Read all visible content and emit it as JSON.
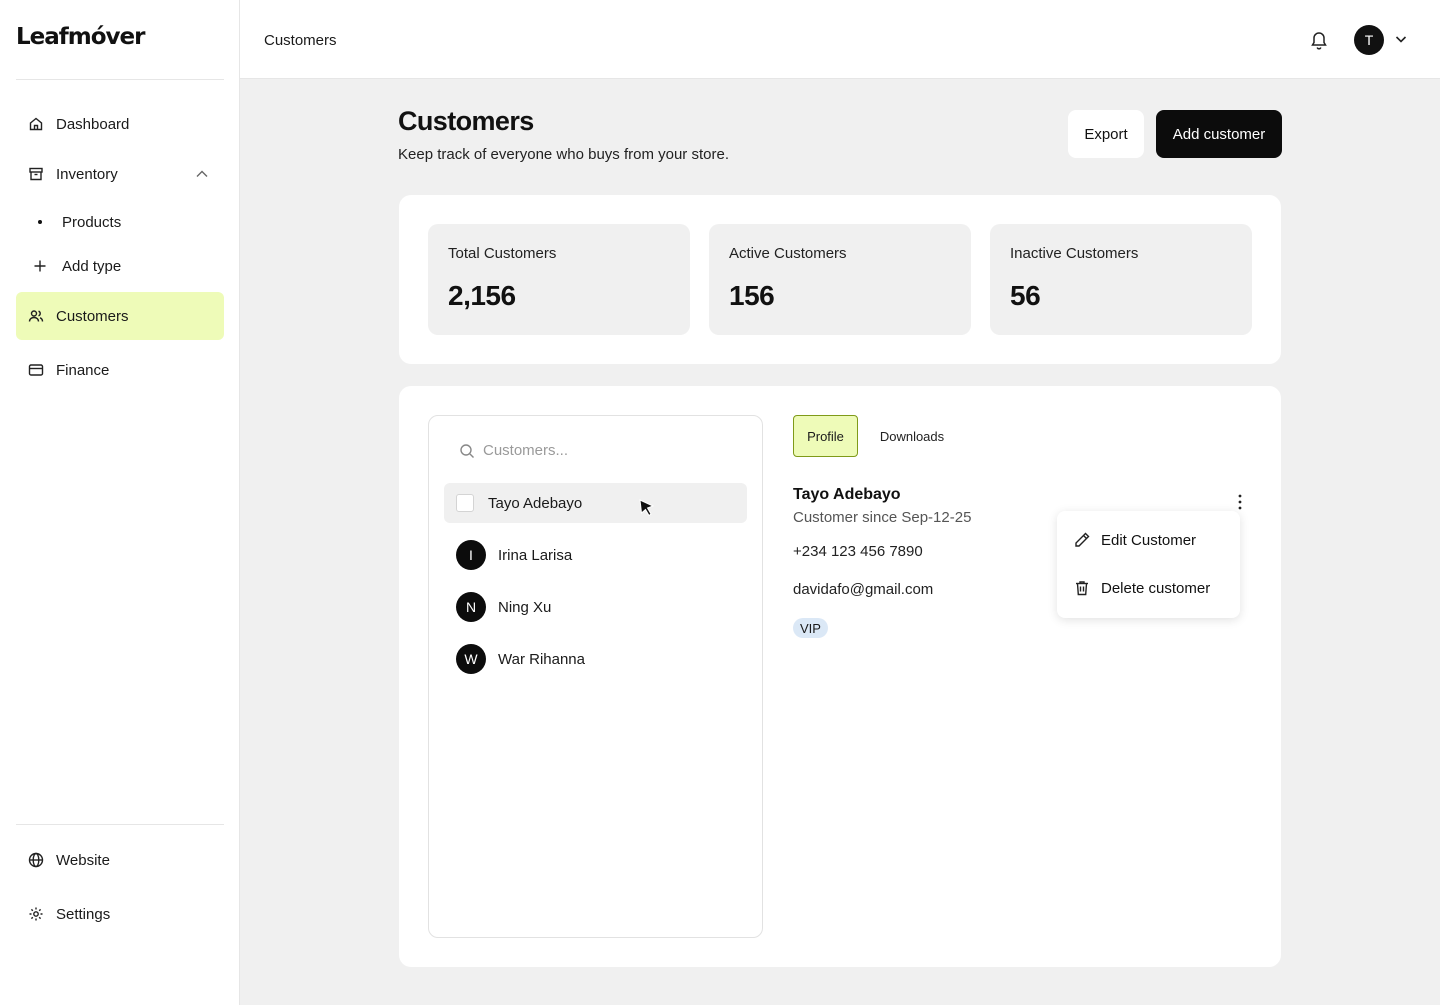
{
  "brand": {
    "name": "Leafmóver"
  },
  "sidebar": {
    "items": [
      {
        "label": "Dashboard",
        "icon": "home-icon"
      },
      {
        "label": "Inventory",
        "icon": "archive-icon"
      },
      {
        "label": "Customers",
        "icon": "users-icon"
      },
      {
        "label": "Finance",
        "icon": "credit-card-icon"
      }
    ],
    "inventory_sub": [
      {
        "label": "Products"
      },
      {
        "label": "Add type"
      }
    ],
    "bottom_items": [
      {
        "label": "Website",
        "icon": "globe-icon"
      },
      {
        "label": "Settings",
        "icon": "gear-icon"
      }
    ]
  },
  "topbar": {
    "breadcrumb": "Customers",
    "avatar_initial": "T"
  },
  "header": {
    "title": "Customers",
    "subtitle": "Keep track of everyone who buys from your store.",
    "export_label": "Export",
    "add_label": "Add customer"
  },
  "stats": [
    {
      "label": "Total Customers",
      "value": "2,156"
    },
    {
      "label": "Active Customers",
      "value": "156"
    },
    {
      "label": "Inactive Customers",
      "value": "56"
    }
  ],
  "customer_list": {
    "search_placeholder": "Customers...",
    "customers": [
      {
        "name": "Tayo Adebayo",
        "initial": ""
      },
      {
        "name": "Irina Larisa",
        "initial": "I"
      },
      {
        "name": "Ning Xu",
        "initial": "N"
      },
      {
        "name": "War Rihanna",
        "initial": "W"
      }
    ]
  },
  "tabs": [
    {
      "label": "Profile"
    },
    {
      "label": "Downloads"
    }
  ],
  "profile": {
    "name": "Tayo Adebayo",
    "since": "Customer since Sep-12-25",
    "phone": "+234 123 456 7890",
    "email": "davidafo@gmail.com",
    "badge": "VIP"
  },
  "context_menu": {
    "edit_label": "Edit Customer",
    "delete_label": "Delete customer"
  },
  "colors": {
    "active_nav_bg": "#eefbb8",
    "primary_button": "#0c0c0c",
    "badge_bg": "#dbe8f6"
  }
}
